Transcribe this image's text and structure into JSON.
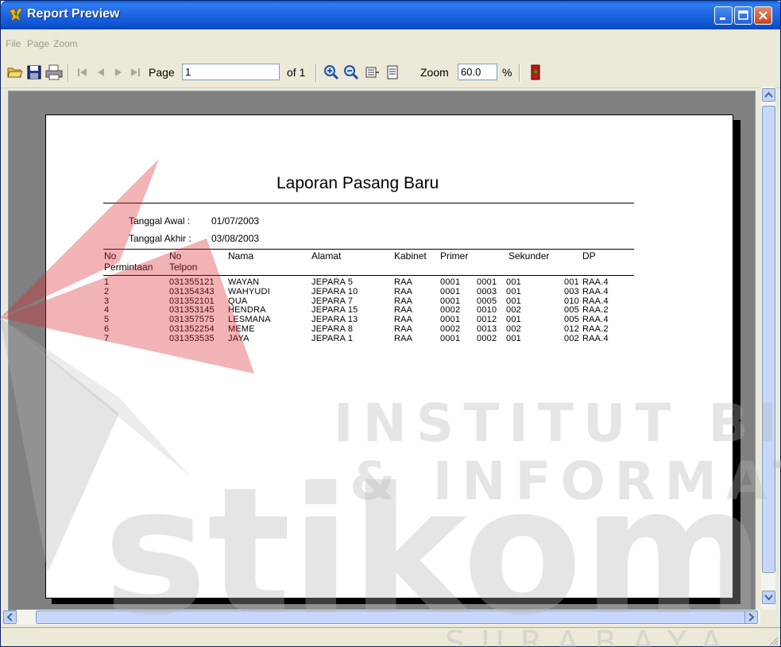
{
  "window": {
    "title": "Report Preview"
  },
  "menu": [
    "File",
    "Page",
    "Zoom"
  ],
  "toolbar": {
    "page_label": "Page",
    "page_value": "1",
    "of_label": "of 1",
    "zoom_label": "Zoom",
    "zoom_value": "60.0",
    "percent_label": "%"
  },
  "report": {
    "title": "Laporan Pasang Baru",
    "tanggal_awal_label": "Tanggal Awal :",
    "tanggal_awal_value": "01/07/2003",
    "tanggal_akhir_label": "Tanggal Akhir :",
    "tanggal_akhir_value": "03/08/2003",
    "headers": {
      "no_permintaan_1": "No",
      "no_permintaan_2": "Permintaan",
      "no_telpon_1": "No",
      "no_telpon_2": "Telpon",
      "nama": "Nama",
      "alamat": "Alamat",
      "kabinet": "Kabinet",
      "primer": "Primer",
      "sekunder": "Sekunder",
      "dp": "DP"
    },
    "rows": [
      {
        "no": "1",
        "telpon": "031355121",
        "nama": "WAYAN",
        "alamat": "JEPARA 5",
        "kabinet": "RAA",
        "primer_a": "0001",
        "primer_b": "0001",
        "sekunder_a": "001",
        "sekunder_b": "001",
        "dp": "RAA.4"
      },
      {
        "no": "2",
        "telpon": "031354343",
        "nama": "WAHYUDI",
        "alamat": "JEPARA 10",
        "kabinet": "RAA",
        "primer_a": "0001",
        "primer_b": "0003",
        "sekunder_a": "001",
        "sekunder_b": "003",
        "dp": "RAA.4"
      },
      {
        "no": "3",
        "telpon": "031352101",
        "nama": "QUA",
        "alamat": "JEPARA 7",
        "kabinet": "RAA",
        "primer_a": "0001",
        "primer_b": "0005",
        "sekunder_a": "001",
        "sekunder_b": "010",
        "dp": "RAA.4"
      },
      {
        "no": "4",
        "telpon": "031353145",
        "nama": "HENDRA",
        "alamat": "JEPARA 15",
        "kabinet": "RAA",
        "primer_a": "0002",
        "primer_b": "0010",
        "sekunder_a": "002",
        "sekunder_b": "005",
        "dp": "RAA.2"
      },
      {
        "no": "5",
        "telpon": "031357575",
        "nama": "LESMANA",
        "alamat": "JEPARA 13",
        "kabinet": "RAA",
        "primer_a": "0001",
        "primer_b": "0012",
        "sekunder_a": "001",
        "sekunder_b": "005",
        "dp": "RAA.4"
      },
      {
        "no": "6",
        "telpon": "031352254",
        "nama": "MEME",
        "alamat": "JEPARA 8",
        "kabinet": "RAA",
        "primer_a": "0002",
        "primer_b": "0013",
        "sekunder_a": "002",
        "sekunder_b": "012",
        "dp": "RAA.2"
      },
      {
        "no": "7",
        "telpon": "031353535",
        "nama": "JAYA",
        "alamat": "JEPARA 1",
        "kabinet": "RAA",
        "primer_a": "0001",
        "primer_b": "0002",
        "sekunder_a": "001",
        "sekunder_b": "002",
        "dp": "RAA.4"
      }
    ]
  },
  "watermark": {
    "line1": "INSTITUT BISNIS",
    "line2": "& INFORMATIKA",
    "brand": "stikom",
    "city": "SURABAYA",
    "red": "#d9262e",
    "gray": "#b4b4b4"
  }
}
